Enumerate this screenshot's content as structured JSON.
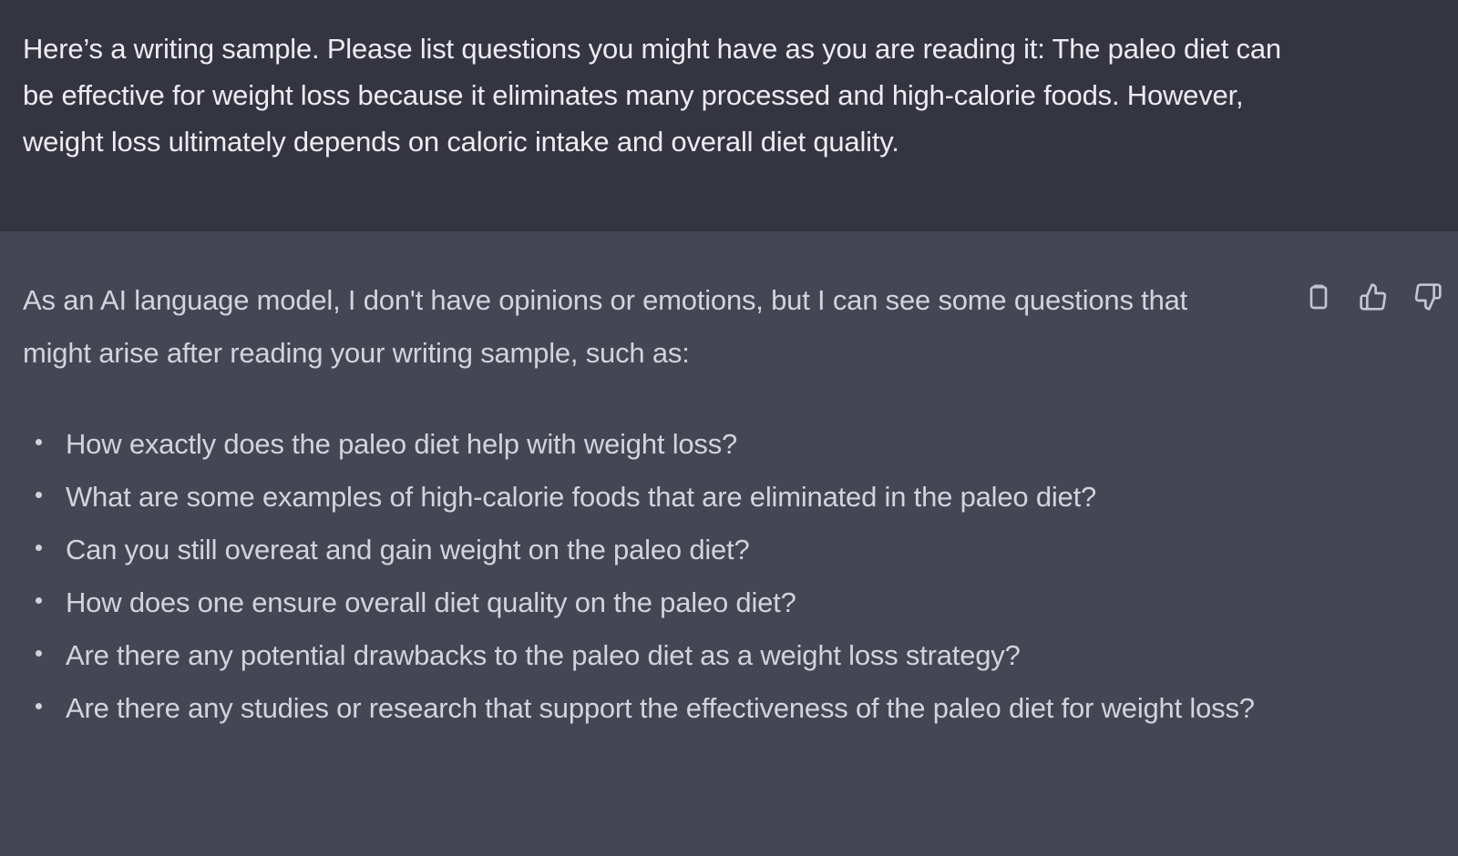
{
  "user_message": {
    "text": "Here’s a writing sample. Please list questions you might have as you are reading it: The paleo diet can be effective for weight loss because it eliminates many processed and high-calorie foods. However, weight loss ultimately depends on caloric intake and overall diet quality."
  },
  "assistant_message": {
    "intro": "As an AI language model, I don't have opinions or emotions, but I can see some questions that might arise after reading your writing sample, such as:",
    "questions": [
      "How exactly does the paleo diet help with weight loss?",
      "What are some examples of high-calorie foods that are eliminated in the paleo diet?",
      "Can you still overeat and gain weight on the paleo diet?",
      "How does one ensure overall diet quality on the paleo diet?",
      "Are there any potential drawbacks to the paleo diet as a weight loss strategy?",
      "Are there any studies or research that support the effectiveness of the paleo diet for weight loss?"
    ],
    "actions": [
      {
        "name": "copy-icon"
      },
      {
        "name": "thumbs-up-icon"
      },
      {
        "name": "thumbs-down-icon"
      }
    ]
  },
  "colors": {
    "user_bg": "#343541",
    "assistant_bg": "#444654",
    "text": "#d1d5db",
    "icon": "#c5c5d2"
  }
}
